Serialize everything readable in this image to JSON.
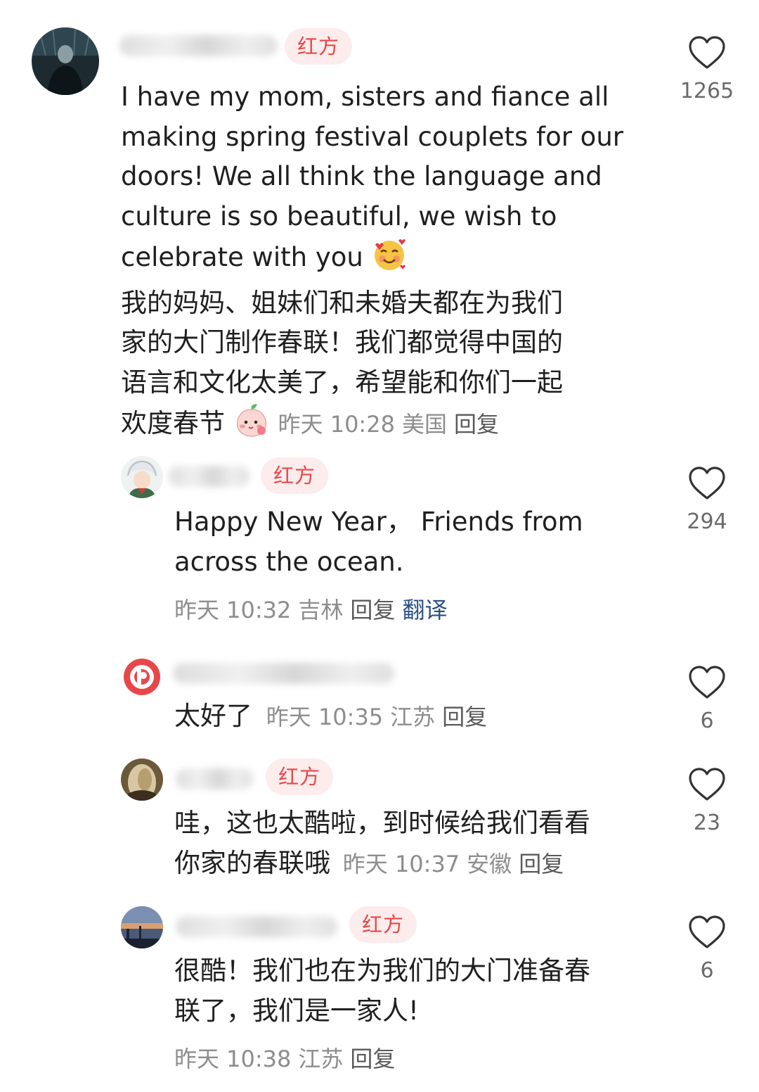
{
  "comments": [
    {
      "badge": "红方",
      "text_lines": [
        "I have my mom, sisters and fiance all",
        "making spring festival couplets for our",
        "doors! We all think the language and",
        "culture is so beautiful, we wish to",
        "celebrate with you",
        "我的妈妈、姐妹们和未婚夫都在为我们",
        "家的大门制作春联！我们都觉得中国的",
        "语言和文化太美了，希望能和你们一起",
        "欢度春节"
      ],
      "emoji_1": "smiling-face-with-hearts-emoji",
      "emoji_2": "peach-character-sticker",
      "time": "昨天 10:28",
      "location": "美国",
      "reply": "回复",
      "likes": "1265"
    },
    {
      "badge": "红方",
      "text_lines": [
        "Happy New Year， Friends from",
        "across the ocean."
      ],
      "time": "昨天 10:32",
      "location": "吉林",
      "reply": "回复",
      "translate": "翻译",
      "likes": "294"
    },
    {
      "text": "太好了",
      "time": "昨天 10:35",
      "location": "江苏",
      "reply": "回复",
      "likes": "6"
    },
    {
      "badge": "红方",
      "text_lines": [
        "哇，这也太酷啦，到时候给我们看看",
        "你家的春联哦"
      ],
      "time": "昨天 10:37",
      "location": "安徽",
      "reply": "回复",
      "likes": "23"
    },
    {
      "badge": "红方",
      "text_lines": [
        "很酷！我们也在为我们的大门准备春",
        "联了，我们是一家人!"
      ],
      "time": "昨天 10:38",
      "location": "江苏",
      "reply": "回复",
      "likes": "6"
    }
  ],
  "icons": {
    "like": "heart-outline-icon"
  },
  "colors": {
    "badge_text": "#e8474a",
    "badge_bg": "#fdecec",
    "meta": "#8d8d8d",
    "translate": "#2b4f86"
  }
}
